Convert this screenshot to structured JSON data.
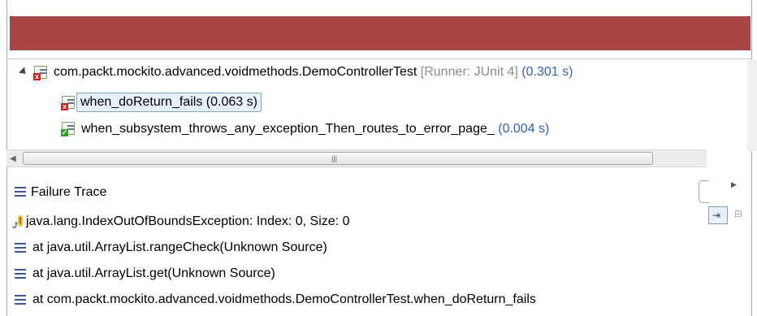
{
  "tree": {
    "root": {
      "class_name": "com.packt.mockito.advanced.voidmethods.DemoControllerTest",
      "runner": "[Runner: JUnit 4]",
      "time": "(0.301 s)"
    },
    "children": [
      {
        "label": "when_doReturn_fails (0.063 s)",
        "status": "fail",
        "selected": true
      },
      {
        "label": "when_subsystem_throws_any_exception_Then_routes_to_error_page_",
        "time": "(0.004 s)",
        "status": "pass"
      }
    ]
  },
  "failure_trace": {
    "title": "Failure Trace",
    "lines": [
      "java.lang.IndexOutOfBoundsException: Index: 0, Size: 0",
      "at java.util.ArrayList.rangeCheck(Unknown Source)",
      "at java.util.ArrayList.get(Unknown Source)",
      "at com.packt.mockito.advanced.voidmethods.DemoControllerTest.when_doReturn_fails"
    ]
  },
  "icons": {
    "expander": "expand-triangle-icon",
    "suite": "test-suite-failed-icon",
    "test_fail": "test-failed-icon",
    "test_pass": "test-passed-icon",
    "stack_frame": "stack-frame-icon",
    "exception": "exception-icon"
  },
  "colors": {
    "failure_bar": "#a84545",
    "time_text": "#3060c8",
    "runner_text": "#8c8c8c"
  }
}
